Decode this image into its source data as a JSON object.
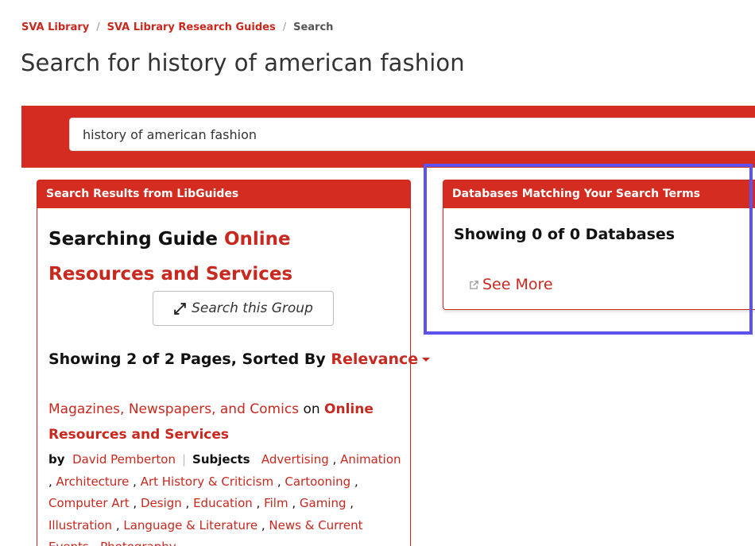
{
  "breadcrumb": {
    "items": [
      "SVA Library",
      "SVA Library Research Guides"
    ],
    "separator": "/",
    "current": "Search"
  },
  "page_title": "Search for history of american fashion",
  "search": {
    "value": "history of american fashion"
  },
  "left_panel": {
    "header": "Search Results from LibGuides",
    "guide_prefix": "Searching Guide",
    "guide_name": "Online Resources and Services",
    "group_button": "Search this Group",
    "showing": "Showing 2 of 2 Pages, Sorted By",
    "sort": "Relevance",
    "result": {
      "title": "Magazines, Newspapers, and Comics",
      "on": "on",
      "guide": "Online Resources and Services",
      "by_label": "by",
      "author": "David Pemberton",
      "subjects_label": "Subjects",
      "subjects": [
        "Advertising",
        "Animation",
        "Architecture",
        "Art History & Criticism",
        "Cartooning",
        "Computer Art",
        "Design",
        "Education",
        "Film",
        "Gaming",
        "Illustration",
        "Language & Literature",
        "News & Current Events",
        "Photography"
      ]
    }
  },
  "right_panel": {
    "header": "Databases Matching Your Search Terms",
    "showing": "Showing 0 of 0 Databases",
    "see_more": "See More"
  },
  "colors": {
    "accent": "#c8281e",
    "band": "#d42c20",
    "highlight": "#5b52f0"
  },
  "icons": {
    "group": "expand-arrows-icon",
    "see_more": "external-link-icon"
  }
}
